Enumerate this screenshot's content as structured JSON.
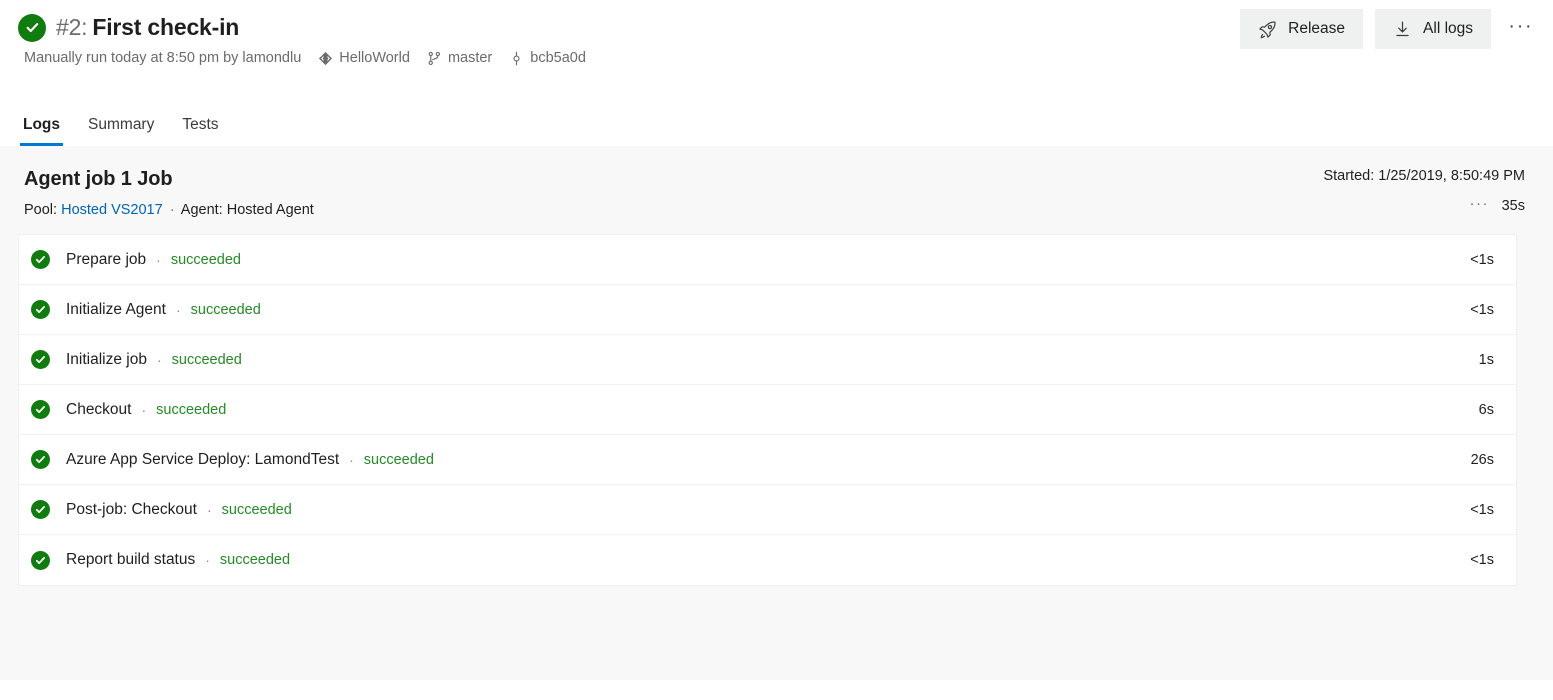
{
  "header": {
    "status_icon": "success-check-icon",
    "build_number": "#2:",
    "build_title": "First check-in",
    "meta_text": "Manually run today at 8:50 pm by lamondlu",
    "meta_items": [
      {
        "icon": "repository-icon",
        "label": "HelloWorld"
      },
      {
        "icon": "branch-icon",
        "label": "master"
      },
      {
        "icon": "commit-icon",
        "label": "bcb5a0d"
      }
    ],
    "actions": {
      "release_label": "Release",
      "release_icon": "rocket-icon",
      "all_logs_label": "All logs",
      "all_logs_icon": "download-icon",
      "more_label": "···"
    }
  },
  "tabs": [
    {
      "label": "Logs",
      "active": true
    },
    {
      "label": "Summary",
      "active": false
    },
    {
      "label": "Tests",
      "active": false
    }
  ],
  "job": {
    "title": "Agent job 1 Job",
    "pool_label": "Pool:",
    "pool_value": "Hosted VS2017",
    "separator": "·",
    "agent_text": "Agent: Hosted Agent",
    "started": "Started: 1/25/2019, 8:50:49 PM",
    "more_dots": "···",
    "duration": "35s"
  },
  "steps": [
    {
      "icon": "success-check-icon",
      "name": "Prepare job",
      "sep": "·",
      "status": "succeeded",
      "time": "<1s"
    },
    {
      "icon": "success-check-icon",
      "name": "Initialize Agent",
      "sep": "·",
      "status": "succeeded",
      "time": "<1s"
    },
    {
      "icon": "success-check-icon",
      "name": "Initialize job",
      "sep": "·",
      "status": "succeeded",
      "time": "1s"
    },
    {
      "icon": "success-check-icon",
      "name": "Checkout",
      "sep": "·",
      "status": "succeeded",
      "time": "6s"
    },
    {
      "icon": "success-check-icon",
      "name": "Azure App Service Deploy: LamondTest",
      "sep": "·",
      "status": "succeeded",
      "time": "26s"
    },
    {
      "icon": "success-check-icon",
      "name": "Post-job: Checkout",
      "sep": "·",
      "status": "succeeded",
      "time": "<1s"
    },
    {
      "icon": "success-check-icon",
      "name": "Report build status",
      "sep": "·",
      "status": "succeeded",
      "time": "<1s"
    }
  ],
  "colors": {
    "success_green": "#107c10",
    "status_text_green": "#268a26",
    "accent_blue": "#0078d4",
    "link_blue": "#0064b4",
    "content_bg": "#f8f8f8"
  }
}
